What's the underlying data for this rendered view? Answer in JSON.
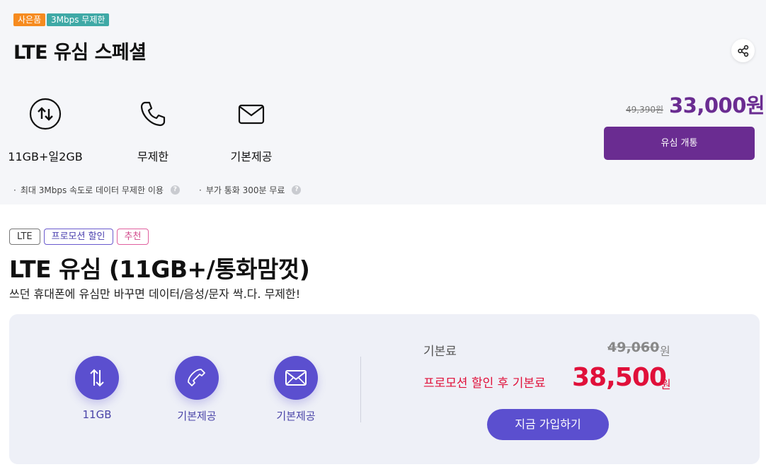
{
  "plan1": {
    "badges": [
      "사은품",
      "3Mbps 무제한"
    ],
    "title": "LTE 유심 스페셜",
    "features": [
      {
        "icon": "data-arrows-icon",
        "label": "11GB+일2GB"
      },
      {
        "icon": "phone-icon",
        "label": "무제한"
      },
      {
        "icon": "mail-icon",
        "label": "기본제공"
      }
    ],
    "original_price": "49,390원",
    "price": "33,000원",
    "button_label": "유심 개통",
    "notes": [
      "최대 3Mbps 속도로 데이터 무제한 이용",
      "부가 통화 300분 무료"
    ],
    "accent_color": "#6a2c91"
  },
  "plan2": {
    "tags": [
      "LTE",
      "프로모션 할인",
      "추천"
    ],
    "title": "LTE 유심 (11GB+/통화맘껏)",
    "subtitle": "쓰던 휴대폰에 유심만 바꾸면 데이터/음성/문자 싹.다. 무제한!",
    "features": [
      {
        "icon": "updown-arrows-icon",
        "label": "11GB"
      },
      {
        "icon": "phone-icon",
        "label": "기본제공"
      },
      {
        "icon": "mail-icon",
        "label": "기본제공"
      }
    ],
    "base_fee_label": "기본료",
    "base_fee": "49,060",
    "currency": "원",
    "promo_label": "프로모션 할인 후 기본료",
    "promo_fee": "38,500",
    "button_label": "지금 가입하기",
    "accent_color": "#5b4fcf",
    "promo_color": "#e0103a"
  }
}
